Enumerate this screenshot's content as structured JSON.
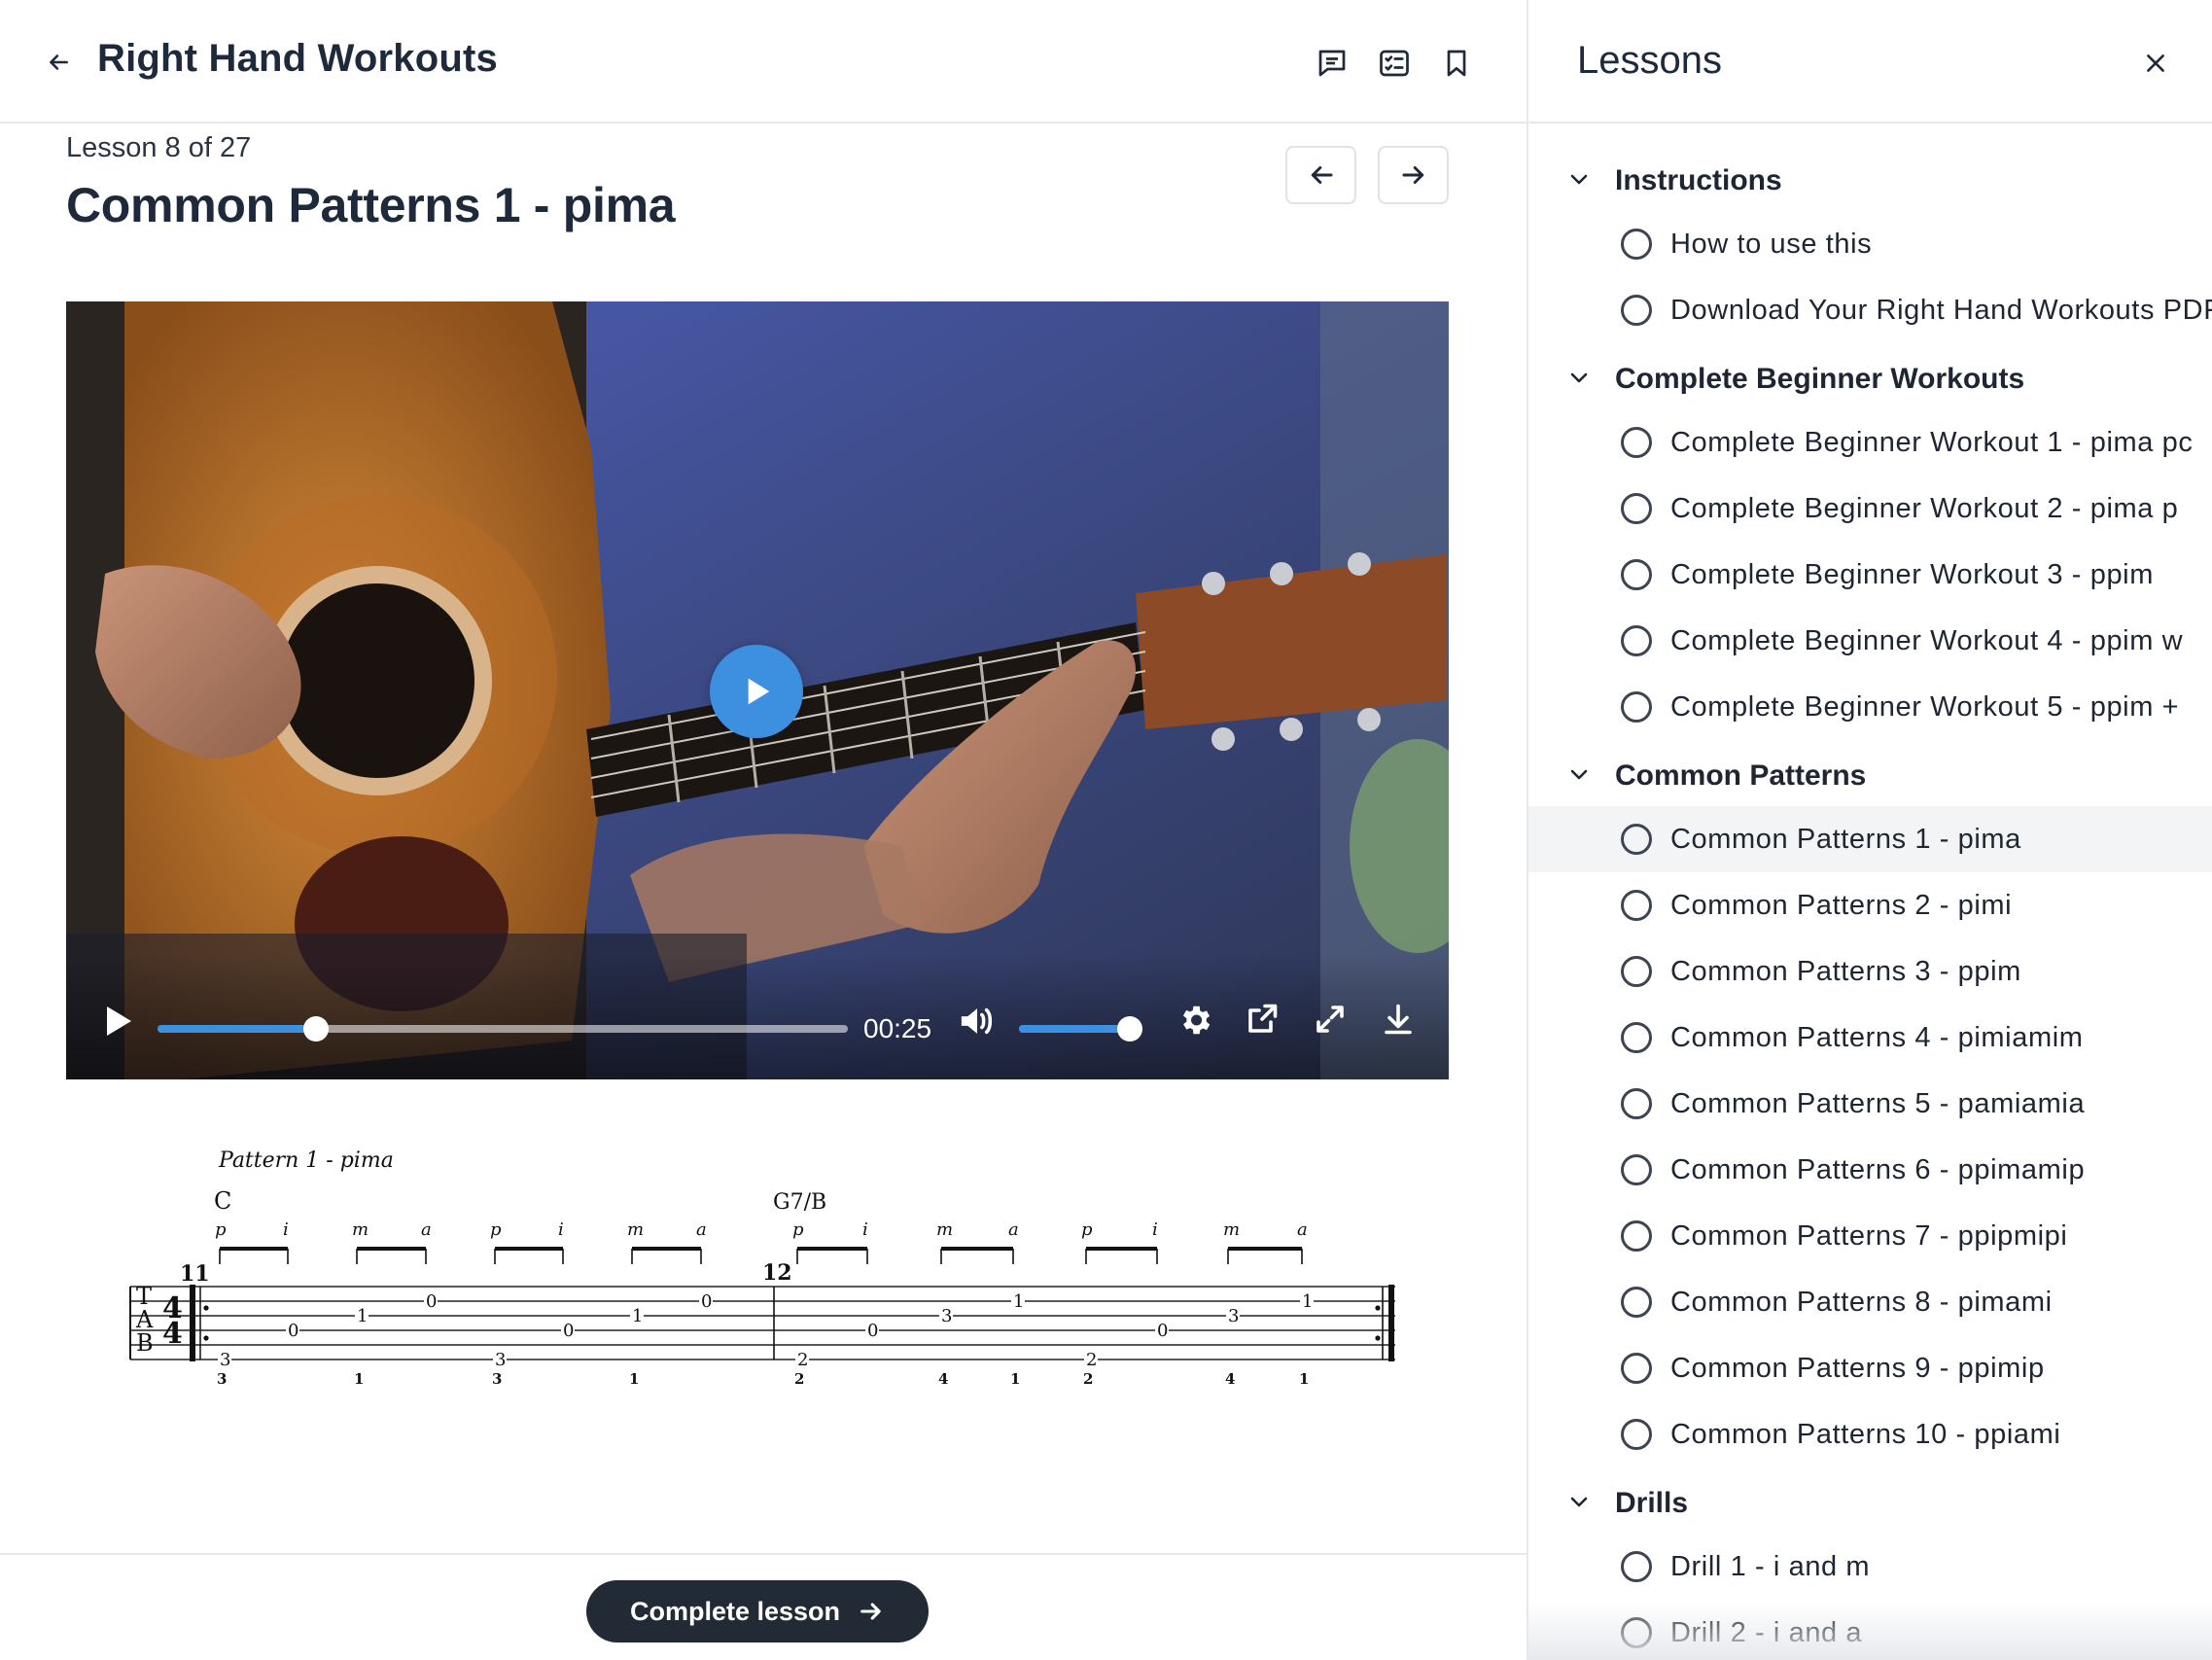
{
  "header": {
    "course_title": "Right Hand Workouts",
    "icons": [
      "back-arrow-icon",
      "comment-icon",
      "checklist-icon",
      "bookmark-icon"
    ]
  },
  "lesson": {
    "count": "Lesson 8 of 27",
    "title": "Common Patterns 1 - pima"
  },
  "video": {
    "time": "00:25",
    "progress_fraction": 0.23,
    "volume_fraction": 0.92
  },
  "tab": {
    "caption": "Pattern 1 - pima",
    "chord1": "C",
    "chord2": "G7/B",
    "measure1": "11",
    "measure2": "12",
    "clef": [
      "T",
      "A",
      "B"
    ],
    "fingers": [
      "p",
      "i",
      "m",
      "a",
      "p",
      "i",
      "m",
      "a",
      "p",
      "i",
      "m",
      "a",
      "p",
      "i",
      "m",
      "a"
    ],
    "fret_numbers_m1": [
      "3",
      "0",
      "1",
      "0",
      "3",
      "0",
      "1",
      "0"
    ],
    "fret_numbers_m2": [
      "2",
      "0",
      "3",
      "1",
      "2",
      "0",
      "3",
      "1"
    ],
    "bottom_numbers": [
      "3",
      "1",
      "3",
      "1",
      "2",
      "4",
      "1",
      "2",
      "4",
      "1"
    ]
  },
  "footer": {
    "complete_label": "Complete lesson"
  },
  "sidebar": {
    "title": "Lessons",
    "sections": [
      {
        "label": "Instructions",
        "lessons": [
          {
            "label": "How to use this"
          },
          {
            "label": "Download Your Right Hand Workouts PDF"
          }
        ]
      },
      {
        "label": "Complete Beginner Workouts",
        "lessons": [
          {
            "label": "Complete Beginner Workout 1 - pima pc"
          },
          {
            "label": "Complete Beginner Workout 2 - pima p"
          },
          {
            "label": "Complete Beginner Workout 3 - ppim"
          },
          {
            "label": "Complete Beginner Workout 4 - ppim w"
          },
          {
            "label": "Complete Beginner Workout 5 - ppim +"
          }
        ]
      },
      {
        "label": "Common Patterns",
        "lessons": [
          {
            "label": "Common Patterns 1 - pima",
            "active": true
          },
          {
            "label": "Common Patterns 2 - pimi"
          },
          {
            "label": "Common Patterns 3 - ppim"
          },
          {
            "label": "Common Patterns 4 - pimiamim"
          },
          {
            "label": "Common Patterns 5 - pamiamia"
          },
          {
            "label": "Common Patterns 6 - ppimamip"
          },
          {
            "label": "Common Patterns 7 - ppipmipi"
          },
          {
            "label": "Common Patterns 8 - pimami"
          },
          {
            "label": "Common Patterns 9 - ppimip"
          },
          {
            "label": "Common Patterns 10 - ppiami"
          }
        ]
      },
      {
        "label": "Drills",
        "lessons": [
          {
            "label": "Drill 1 - i and m"
          },
          {
            "label": "Drill 2 - i and a"
          }
        ]
      }
    ]
  },
  "colors": {
    "accent_blue": "#3d8fe0",
    "dark_button": "#222a35",
    "text_dark": "#1e2a3b",
    "border": "#e6e8ec"
  }
}
